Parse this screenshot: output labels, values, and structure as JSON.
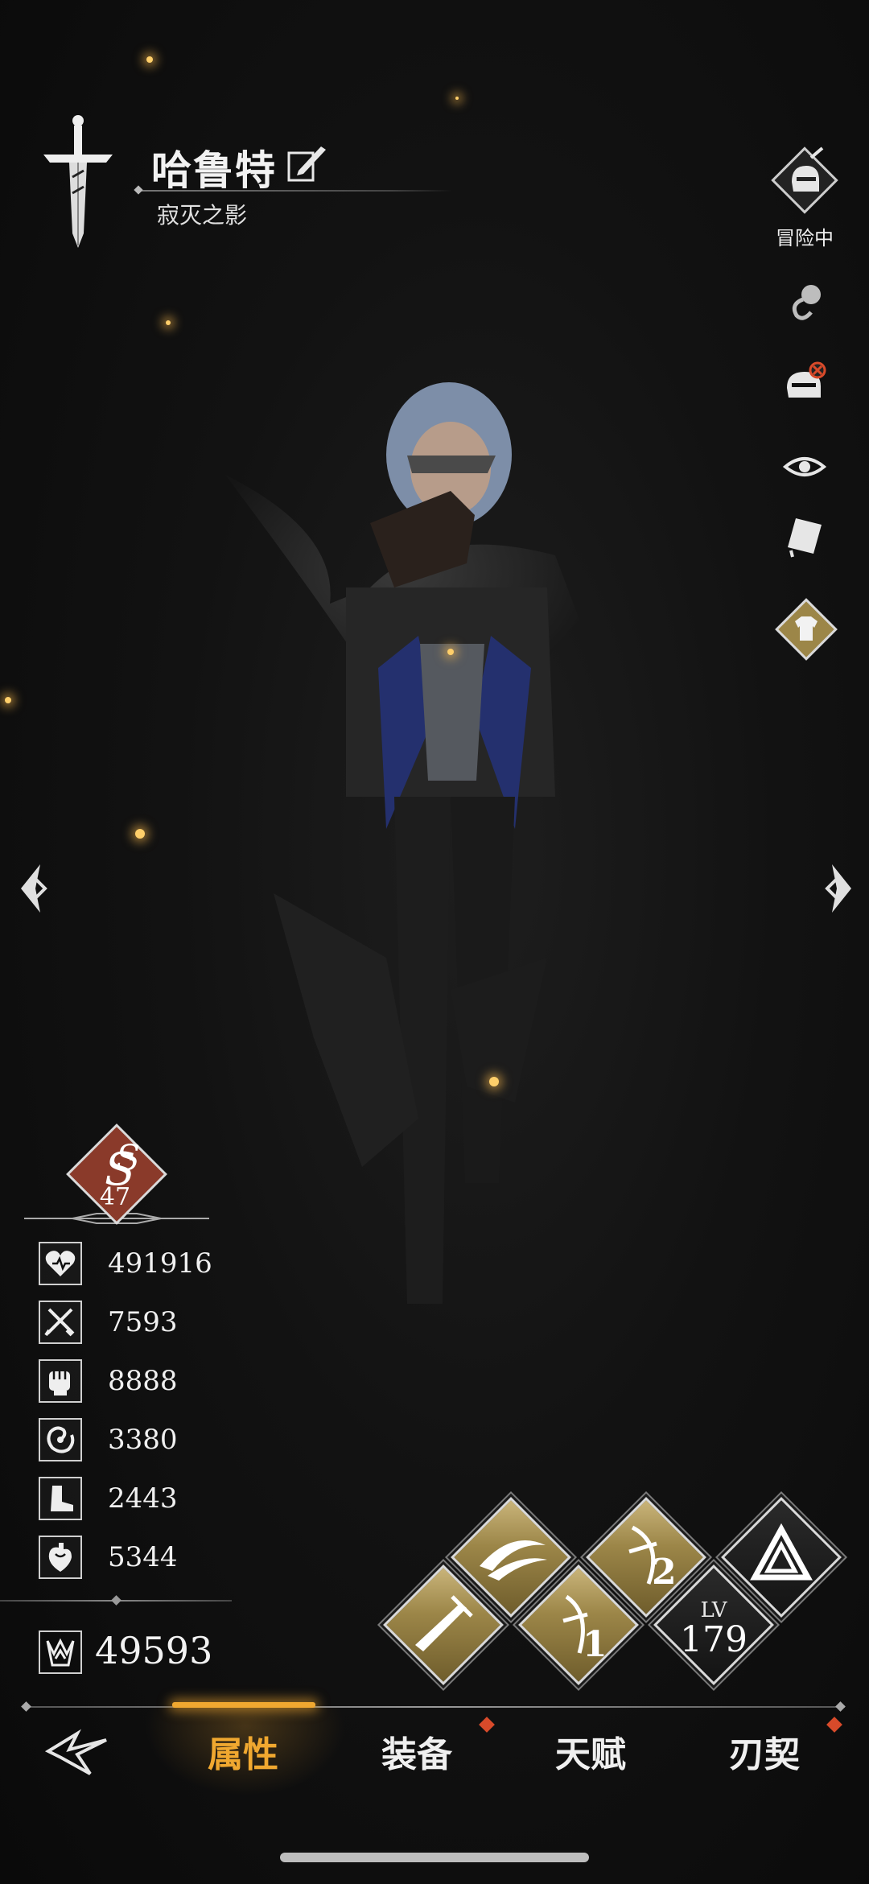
{
  "header": {
    "character_name": "哈鲁特",
    "character_title": "寂灭之影"
  },
  "status": {
    "label": "冒险中"
  },
  "rank": {
    "level": "47"
  },
  "stats": [
    {
      "icon": "heart-icon",
      "value": "491916"
    },
    {
      "icon": "crossed-swords-icon",
      "value": "7593"
    },
    {
      "icon": "fist-icon",
      "value": "8888"
    },
    {
      "icon": "vortex-icon",
      "value": "3380"
    },
    {
      "icon": "boot-icon",
      "value": "2443"
    },
    {
      "icon": "anatomical-heart-icon",
      "value": "5344"
    }
  ],
  "power": {
    "value": "49593"
  },
  "skills": {
    "slot_1_number": "2",
    "slot_2_number": "1",
    "lv_label": "LV",
    "lv_value": "179"
  },
  "tabs": [
    {
      "label": "属性",
      "active": true
    },
    {
      "label": "装备",
      "active": false,
      "has_alert": true
    },
    {
      "label": "天赋",
      "active": false
    },
    {
      "label": "刃契",
      "active": false,
      "has_alert": true
    }
  ],
  "colors": {
    "accent": "#f0a830",
    "alert": "#d84a2a",
    "rank_badge": "#8a3a2a",
    "skill_gold": "#9c8648"
  }
}
